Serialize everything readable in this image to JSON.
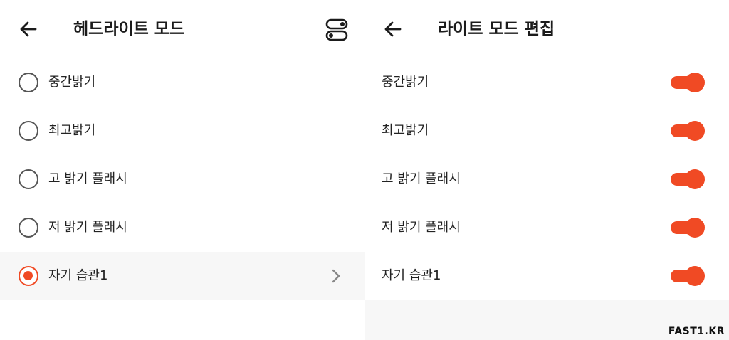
{
  "left_panel": {
    "title": "헤드라이트 모드",
    "back_icon": "arrow-left-icon",
    "edit_icon": "toggles-icon",
    "options": [
      {
        "label": "중간밝기",
        "selected": false
      },
      {
        "label": "최고밝기",
        "selected": false
      },
      {
        "label": "고 밝기 플래시",
        "selected": false
      },
      {
        "label": "저 밝기 플래시",
        "selected": false
      },
      {
        "label": "자기 습관1",
        "selected": true
      }
    ]
  },
  "right_panel": {
    "title": "라이트 모드 편집",
    "back_icon": "arrow-left-icon",
    "items": [
      {
        "label": "중간밝기",
        "enabled": true
      },
      {
        "label": "최고밝기",
        "enabled": true
      },
      {
        "label": "고 밝기 플래시",
        "enabled": true
      },
      {
        "label": "저 밝기 플래시",
        "enabled": true
      },
      {
        "label": "자기 습관1",
        "enabled": true
      }
    ]
  },
  "colors": {
    "accent": "#f04a24",
    "selected_row_bg": "#f7f7f7"
  },
  "watermark": "FAST1.KR"
}
